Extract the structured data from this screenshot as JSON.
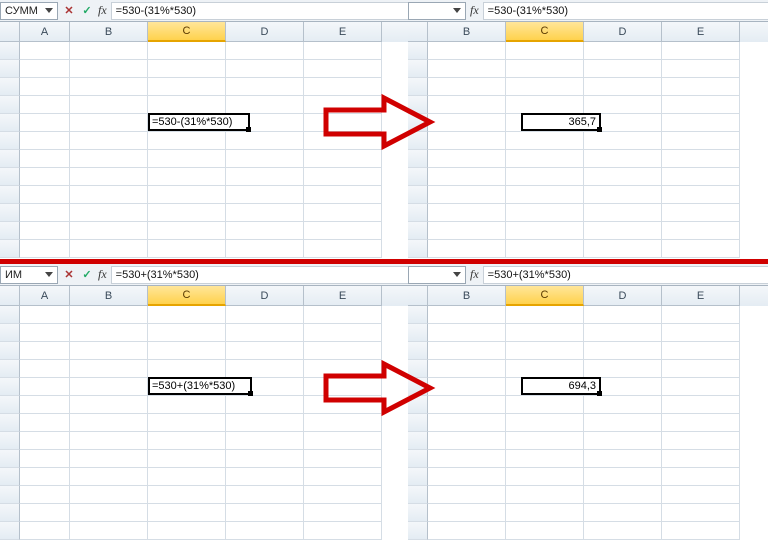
{
  "cols": {
    "A": "A",
    "B": "B",
    "C": "C",
    "D": "D",
    "E": "E"
  },
  "icons": {
    "fx": "fx",
    "cancel": "✕",
    "accept": "✓",
    "dropdown": "▼"
  },
  "q1": {
    "namebox": "СУММ",
    "formula": "=530-(31%*530)",
    "cell_display": "=530-(31%*530)",
    "selected_col": "C"
  },
  "q2": {
    "namebox": "",
    "formula": "=530-(31%*530)",
    "cell_display": "365,7",
    "selected_col": "C"
  },
  "q3": {
    "namebox": "ИМ",
    "formula": "=530+(31%*530)",
    "cell_display": "=530+(31%*530)",
    "selected_col": "C"
  },
  "q4": {
    "namebox": "",
    "formula": "=530+(31%*530)",
    "cell_display": "694,3",
    "selected_col": "C"
  }
}
